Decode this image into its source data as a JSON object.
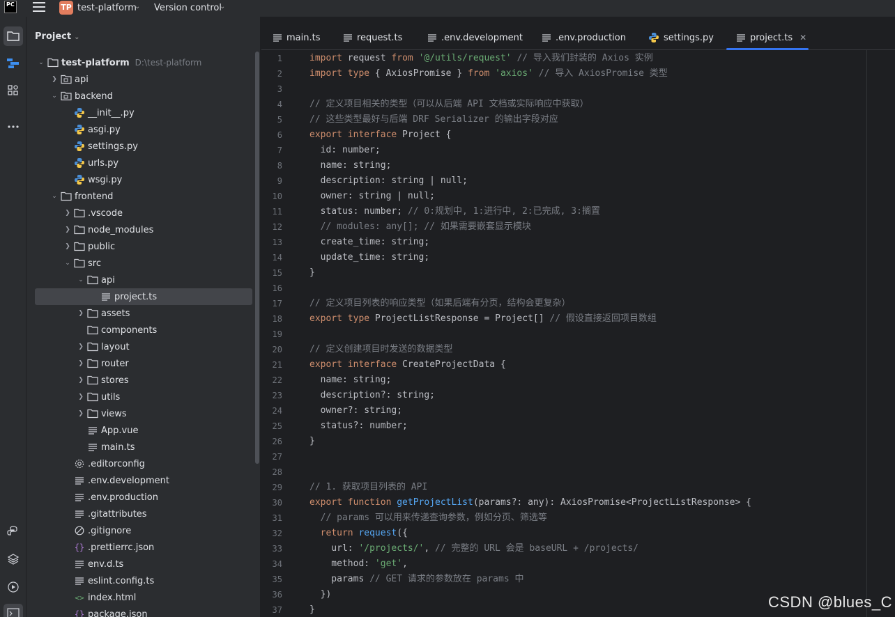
{
  "titlebar": {
    "logo_line1": "PC",
    "logo_line2": "",
    "project_badge": "TP",
    "project_name": "test-platform",
    "vcs_label": "Version control"
  },
  "project_panel": {
    "title": "Project",
    "root_name": "test-platform",
    "root_path": "D:\\test-platform",
    "items": [
      {
        "label": "api"
      },
      {
        "label": "backend"
      },
      {
        "label": "__init__.py"
      },
      {
        "label": "asgi.py"
      },
      {
        "label": "settings.py"
      },
      {
        "label": "urls.py"
      },
      {
        "label": "wsgi.py"
      },
      {
        "label": "frontend"
      },
      {
        "label": ".vscode"
      },
      {
        "label": "node_modules"
      },
      {
        "label": "public"
      },
      {
        "label": "src"
      },
      {
        "label": "api"
      },
      {
        "label": "project.ts"
      },
      {
        "label": "assets"
      },
      {
        "label": "components"
      },
      {
        "label": "layout"
      },
      {
        "label": "router"
      },
      {
        "label": "stores"
      },
      {
        "label": "utils"
      },
      {
        "label": "views"
      },
      {
        "label": "App.vue"
      },
      {
        "label": "main.ts"
      },
      {
        "label": ".editorconfig"
      },
      {
        "label": ".env.development"
      },
      {
        "label": ".env.production"
      },
      {
        "label": ".gitattributes"
      },
      {
        "label": ".gitignore"
      },
      {
        "label": ".prettierrc.json"
      },
      {
        "label": "env.d.ts"
      },
      {
        "label": "eslint.config.ts"
      },
      {
        "label": "index.html"
      },
      {
        "label": "package.json"
      }
    ]
  },
  "tabs": [
    {
      "label": "main.ts"
    },
    {
      "label": "request.ts"
    },
    {
      "label": ".env.development"
    },
    {
      "label": ".env.production"
    },
    {
      "label": "settings.py"
    },
    {
      "label": "project.ts",
      "active": true
    }
  ],
  "editor": {
    "line_numbers": [
      "1",
      "2",
      "3",
      "4",
      "5",
      "6",
      "7",
      "8",
      "9",
      "10",
      "11",
      "12",
      "13",
      "14",
      "15",
      "16",
      "17",
      "18",
      "19",
      "20",
      "21",
      "22",
      "23",
      "24",
      "25",
      "26",
      "27",
      "28",
      "29",
      "30",
      "31",
      "32",
      "33",
      "34",
      "35",
      "36",
      "37"
    ]
  },
  "colors": {
    "keyword": "#cf8e6d",
    "string": "#6aab73",
    "comment": "#7a7e85",
    "function": "#56a8f5",
    "accent": "#3574f0"
  },
  "watermark": "CSDN @blues_C"
}
